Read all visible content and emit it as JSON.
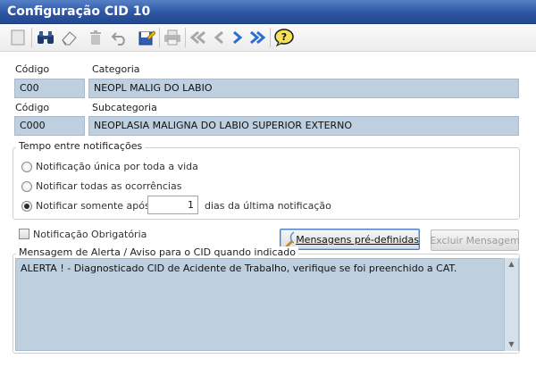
{
  "window": {
    "title": "Configuração CID 10"
  },
  "toolbar": {
    "buttons": [
      {
        "name": "new-record-icon"
      },
      {
        "name": "search-binoculars-icon"
      },
      {
        "name": "eraser-icon"
      },
      {
        "name": "delete-trash-icon"
      },
      {
        "name": "undo-icon"
      },
      {
        "name": "edit-save-icon"
      },
      {
        "name": "print-icon"
      },
      {
        "name": "first-record-icon"
      },
      {
        "name": "previous-record-icon"
      },
      {
        "name": "next-record-icon"
      },
      {
        "name": "last-record-icon"
      },
      {
        "name": "help-icon"
      }
    ]
  },
  "form": {
    "codigo_label": "Código",
    "categoria_label": "Categoria",
    "categoria_code": "C00",
    "categoria_value": "NEOPL MALIG DO LABIO",
    "codigo2_label": "Código",
    "subcategoria_label": "Subcategoria",
    "subcategoria_code": "C000",
    "subcategoria_value": "NEOPLASIA MALIGNA DO LABIO SUPERIOR EXTERNO"
  },
  "notifications": {
    "group_title": "Tempo entre notificações",
    "options": [
      {
        "label": "Notificação única por toda a vida",
        "selected": false
      },
      {
        "label": "Notificar todas as ocorrências",
        "selected": false
      },
      {
        "label": "Notificar somente após",
        "selected": true
      }
    ],
    "days_value": "1",
    "days_suffix": "dias da última notificação"
  },
  "mandatory": {
    "label": "Notificação Obrigatória",
    "checked": false
  },
  "buttons": {
    "predefined_messages": "Mensagens pré-definidas",
    "delete_message": "Excluir Mensagem"
  },
  "alert": {
    "group_title": "Mensagem de Alerta / Aviso para o CID quando indicado",
    "message": "ALERTA ! - Diagnosticado CID de Acidente de Trabalho, verifique se foi preenchido a CAT."
  },
  "colors": {
    "title_bar": "#2d55a4",
    "field_background": "#bed0e0",
    "accent_blue": "#2c6fd1"
  }
}
